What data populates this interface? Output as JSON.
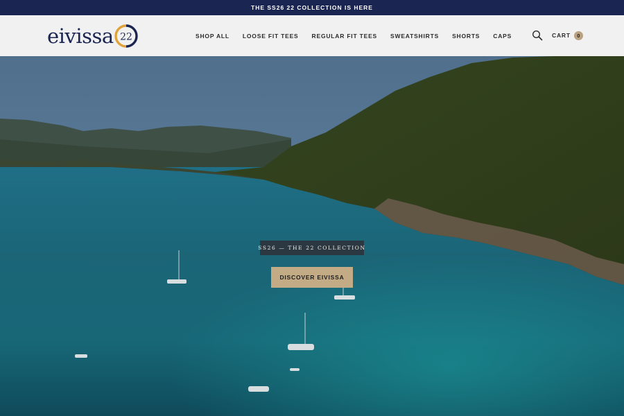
{
  "announcement": {
    "text": "THE SS26 22 COLLECTION IS HERE"
  },
  "brand": {
    "wordmark": "eivissa",
    "badge_number": "22",
    "colors": {
      "navy": "#1b2551",
      "gold": "#e0a33a"
    }
  },
  "nav": {
    "items": [
      {
        "label": "SHOP ALL"
      },
      {
        "label": "LOOSE FIT TEES"
      },
      {
        "label": "REGULAR FIT TEES"
      },
      {
        "label": "SWEATSHIRTS"
      },
      {
        "label": "SHORTS"
      },
      {
        "label": "CAPS"
      }
    ]
  },
  "header": {
    "search_icon": "search-icon",
    "cart_label": "CART",
    "cart_count": "0"
  },
  "hero": {
    "eyebrow": "SS26 — THE 22 COLLECTION",
    "cta_label": "DISCOVER EIVISSA",
    "accent": "#c3ab86"
  }
}
